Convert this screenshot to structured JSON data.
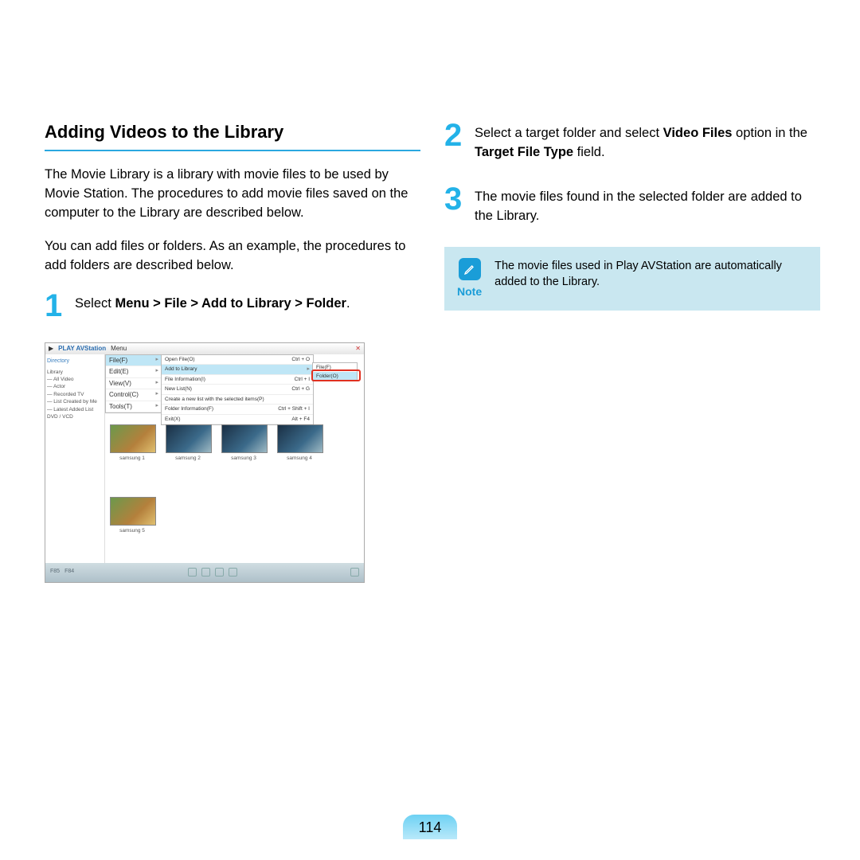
{
  "page_number": "114",
  "left": {
    "title": "Adding Videos to the Library",
    "para1": "The Movie Library is a library with movie files to be used by Movie Station. The procedures to add movie files saved on the computer to the Library are described below.",
    "para2": "You can add files or folders. As an example, the procedures to add folders are described below.",
    "step1_num": "1",
    "step1_pre": "Select ",
    "step1_bold": "Menu > File > Add to Library > Folder",
    "step1_post": "."
  },
  "right": {
    "step2_num": "2",
    "step2_parts": [
      "Select a target folder and select ",
      "Video Files",
      " option in the ",
      "Target File Type",
      " field."
    ],
    "step3_num": "3",
    "step3": "The movie files found in the selected folder are added to the Library.",
    "note_label": "Note",
    "note_text": "The movie files used in Play AVStation are automatically added to the Library."
  },
  "shot": {
    "appTitle": "PLAY AVStation",
    "menuLabel": "Menu",
    "sidebar": {
      "header": "Directory",
      "items": [
        "Library",
        "— All Video",
        "— Actor",
        "— Recorded TV",
        "— List Created by Me",
        "— Latest Added List",
        "DVD / VCD"
      ]
    },
    "menu1": [
      {
        "l": "File(F)",
        "r": "▸",
        "hl": true
      },
      {
        "l": "Edit(E)",
        "r": "▸"
      },
      {
        "l": "View(V)",
        "r": "▸"
      },
      {
        "l": "Control(C)",
        "r": "▸"
      },
      {
        "l": "Tools(T)",
        "r": "▸"
      }
    ],
    "menu2": [
      {
        "l": "Open File(O)",
        "r": "Ctrl + O"
      },
      {
        "l": "Add to Library",
        "r": "▸",
        "hl": true
      },
      {
        "l": "File Information(I)",
        "r": "Ctrl + I"
      },
      {
        "l": "New List(N)",
        "r": "Ctrl + G"
      },
      {
        "l": "Create a new list with the selected items(P)",
        "r": ""
      },
      {
        "l": "Folder Information(F)",
        "r": "Ctrl + Shift + I"
      },
      {
        "l": "Exit(X)",
        "r": "Alt + F4"
      }
    ],
    "menu3": [
      {
        "l": "File(F)"
      },
      {
        "l": "Folder(O)",
        "hl": true
      }
    ],
    "thumbs": [
      "samsung 1",
      "samsung 2",
      "samsung 3",
      "samsung 4",
      "samsung 5"
    ],
    "bottom": {
      "l1": "F85",
      "l2": "F84"
    }
  }
}
